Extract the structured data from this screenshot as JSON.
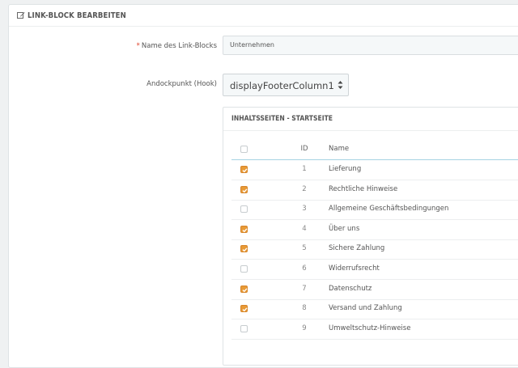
{
  "panel": {
    "title": "LINK-BLOCK BEARBEITEN"
  },
  "form": {
    "name_required_mark": "*",
    "name_label": "Name des Link-Blocks",
    "name_value": "Unternehmen",
    "hook_label": "Andockpunkt (Hook)",
    "hook_value": "displayFooterColumn1"
  },
  "cms": {
    "title": "INHALTSSEITEN - STARTSEITE",
    "header": {
      "id": "ID",
      "name": "Name"
    },
    "rows": [
      {
        "id": "1",
        "name": "Lieferung",
        "checked": true
      },
      {
        "id": "2",
        "name": "Rechtliche Hinweise",
        "checked": true
      },
      {
        "id": "3",
        "name": "Allgemeine Geschäftsbedingungen",
        "checked": false
      },
      {
        "id": "4",
        "name": "Über uns",
        "checked": true
      },
      {
        "id": "5",
        "name": "Sichere Zahlung",
        "checked": true
      },
      {
        "id": "6",
        "name": "Widerrufsrecht",
        "checked": false
      },
      {
        "id": "7",
        "name": "Datenschutz",
        "checked": true
      },
      {
        "id": "8",
        "name": "Versand und Zahlung",
        "checked": true
      },
      {
        "id": "9",
        "name": "Umweltschutz-Hinweise",
        "checked": false
      }
    ]
  },
  "colors": {
    "checkbox_on": "#e89a36",
    "accent_line": "#a6d3e3"
  }
}
